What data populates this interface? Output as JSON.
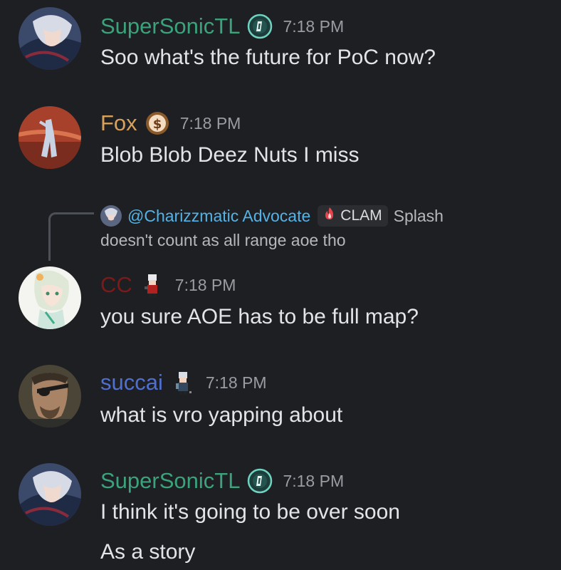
{
  "messages": [
    {
      "username": "SuperSonicTL",
      "name_color": "#3aa37c",
      "badge": "teal-shield-badge-icon",
      "time": "7:18 PM",
      "lines": [
        "Soo what's the future for PoC now?"
      ]
    },
    {
      "username": "Fox",
      "name_color": "#d6a15c",
      "badge": "dollar-coin-badge-icon",
      "time": "7:18 PM",
      "lines": [
        "Blob Blob Deez Nuts I miss"
      ]
    },
    {
      "username": "CC",
      "name_color": "#7a1a1a",
      "badge": "pixel-character-icon",
      "time": "7:18 PM",
      "lines": [
        "you sure AOE has to be full map?"
      ],
      "reply": {
        "mention": "@Charizzmatic Advocate",
        "tag": "CLAM",
        "tag_icon": "flame-icon",
        "text_part1": "Splash",
        "text_part2": "doesn't count as all range aoe tho"
      }
    },
    {
      "username": "succai",
      "name_color": "#4f6fd1",
      "badge": "pixel-character-icon",
      "time": "7:18 PM",
      "lines": [
        "what is vro yapping about"
      ]
    },
    {
      "username": "SuperSonicTL",
      "name_color": "#3aa37c",
      "badge": "teal-shield-badge-icon",
      "time": "7:18 PM",
      "lines": [
        "I think it's going to be over soon",
        "As a story"
      ]
    }
  ]
}
